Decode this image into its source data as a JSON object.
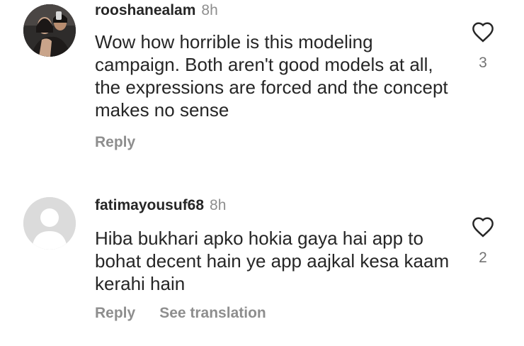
{
  "comments": [
    {
      "username": "rooshanealam",
      "time": "8h",
      "text": "Wow how horrible is this modeling campaign. Both aren't good models at all, the expressions are forced and the concept makes no sense",
      "reply_label": "Reply",
      "likes": "3",
      "avatar_icon": "profile-photo"
    },
    {
      "username": "fatimayousuf68",
      "time": "8h",
      "text": "Hiba bukhari apko hokia gaya hai app to bohat decent hain ye app aajkal kesa kaam kerahi hain",
      "reply_label": "Reply",
      "see_translation_label": "See translation",
      "likes": "2",
      "avatar_icon": "default-avatar-icon"
    }
  ],
  "colors": {
    "text": "#262626",
    "secondary": "#8e8e8e",
    "avatar_default": "#dbdbdb"
  }
}
